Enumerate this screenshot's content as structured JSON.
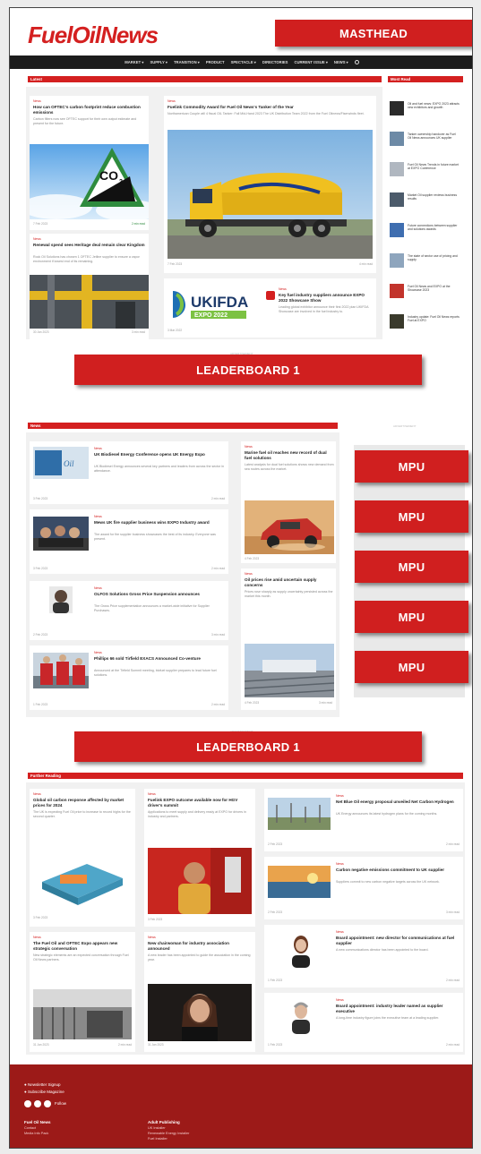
{
  "header": {
    "logo_text": "FuelOilNews",
    "nav": [
      "MARKET ▾",
      "SUPPLY ▾",
      "TRANSITION ▾",
      "PRODUCT",
      "SPECTACLE ▾",
      "DIRECTORIES",
      "CURRENT ISSUE ▾",
      "NEWS ▾"
    ]
  },
  "labels": {
    "masthead": "MASTHEAD",
    "leaderboard_1": "LEADERBOARD 1",
    "leaderboard_2": "LEADERBOARD 1",
    "mpu": "MPU"
  },
  "sections": {
    "latest": "Latest",
    "most_read": "Most Read",
    "news": "News",
    "further_reading": "Further Reading",
    "advert": "ADVERTISEMENT"
  },
  "latest": {
    "col1": [
      {
        "cat": "News",
        "title": "How can OFTEC's carbon footprint reduce combustion emissions",
        "excerpt": "Carbon filters now see OFTEC support for their own output estimate and present for the future.",
        "date": "7 Feb 2023",
        "meta": "2 min read"
      },
      {
        "cat": "News",
        "title": "Renewal spend sees Heritage deal remain clear Kingdom",
        "excerpt": "Rock Oil Solutions has chosen 1 OFTEC Jetline supplier to ensure a vapor environment if lowest end of its remaining.",
        "date": "30 Jan 2023",
        "meta": "3 min read"
      }
    ],
    "feature": {
      "cat": "News",
      "title": "Fuelink Commodity Award for Fuel Oil News's Tanker of the Year",
      "excerpt": "Northamerican Couple will 4 fiscal OIL Tanker: Fall Mid-Hand 2023 The UK Distribution Team 2022 from the Fuel Oilnews/Fiserwinds fleet.",
      "date": "7 Feb 2023",
      "meta": "4 min read"
    },
    "expo": {
      "logo_main": "UKIFDA",
      "logo_sub": "EXPO 2022",
      "cat": "News",
      "title": "Key fuel industry suppliers announce EXPO 2022 Showcase Show",
      "excerpt": "Leading global exhibitor announce their first 2022 plan UKIFDA Showcase are involved in the fuel industry to.",
      "date": "3 Mar 2022"
    }
  },
  "most_read": [
    "Oil and fuel news: EXPO 2023 attracts new exhibitors and growth",
    "Tanker ownership handover as Fuel Oil News announces UK supplier",
    "Fuel Oil News Trends in future market at EXPO Conference",
    "Market Oil supplier reviews business results",
    "Future connections between supplier and solutions awards",
    "The state of sector use of pricing and supply",
    "Fuel Oil News and EXPO at the Showcase 2023",
    "Industry update: Fuel Oil News reports Fuel at EXPO"
  ],
  "news": {
    "left": [
      {
        "cat": "News",
        "title": "UK Biodiesel Energy Conference opens UK Energy Expo",
        "excerpt": "UK Biodiesel Energy announces several key partners and leaders from across the sector in attendance.",
        "date": "3 Feb 2023",
        "meta": "2 min read"
      },
      {
        "cat": "News",
        "title": "Mews UK fire supplier business wins EXPO Industry award",
        "excerpt": "The award for fire supplier business showcases the best of its industry. Everyone was present.",
        "date": "3 Feb 2023",
        "meta": "2 min read"
      },
      {
        "cat": "News",
        "title": "OLFOS Solutions Gross Price Suspension announces",
        "excerpt": "The Gross Price supplementation announces a market-wide initiative for Supplier Purchases.",
        "date": "2 Feb 2023",
        "meta": "3 min read"
      },
      {
        "cat": "News",
        "title": "Phillips 66 sold Tirfield EXACS Announced Co-venture",
        "excerpt": "Announced at the Tirfield Summit meeting, biofuel supplier prepares to lead future fuel solutions.",
        "date": "1 Feb 2023",
        "meta": "2 min read"
      }
    ],
    "right": [
      {
        "cat": "News",
        "title": "Marine fuel oil reaches new record of dual fuel solutions",
        "excerpt": "Latest analysis for dual fuel solutions shows new demand from sea routes across the market.",
        "date": "4 Feb 2023",
        "meta": "2 min read"
      },
      {
        "cat": "News",
        "title": "Oil prices rise amid uncertain supply concerns",
        "excerpt": "Prices rose sharply as supply uncertainty persisted across the market this month.",
        "date": "4 Feb 2023",
        "meta": "3 min read"
      }
    ]
  },
  "further": {
    "col1": [
      {
        "cat": "News",
        "title": "Global oil carbon response affected by market prices for 2024",
        "excerpt": "The UK is expecting Fuel Oil price to increase to record highs for the second quarter.",
        "date": "3 Feb 2023",
        "meta": "2 min read"
      },
      {
        "cat": "News",
        "title": "The Fuel Oil and OFTEC Expo appears new strategic conversation",
        "excerpt": "New strategic elements are an expected conversation through Fuel Oil News partners.",
        "date": "31 Jan 2023",
        "meta": "2 min read"
      }
    ],
    "col2": [
      {
        "cat": "News",
        "title": "Fuelink EXPO outcome available now for HGV driver's summit",
        "excerpt": "Applications to meet supply and delivery ready at EXPO for drivers in industry and partners.",
        "date": "3 Feb 2023",
        "meta": "2 min read"
      },
      {
        "cat": "News",
        "title": "New chairwoman for industry association announced",
        "excerpt": "A new leader has been appointed to guide the association in the coming year.",
        "date": "31 Jan 2023",
        "meta": "2 min read"
      }
    ],
    "right": [
      {
        "cat": "News",
        "title": "Net Blue Oil energy proposal unveiled Net Carbon Hydrogen",
        "excerpt": "UK Energy announces its latest hydrogen plans for the coming months.",
        "date": "2 Feb 2023",
        "meta": "2 min read"
      },
      {
        "cat": "News",
        "title": "Carbon negative emissions commitment to UK supplier",
        "excerpt": "Suppliers commit to new carbon negative targets across the UK network.",
        "date": "2 Feb 2023",
        "meta": "3 min read"
      },
      {
        "cat": "News",
        "title": "Board appointment: new director for communications at fuel supplier",
        "excerpt": "A new communications director has been appointed to the board.",
        "date": "1 Feb 2023",
        "meta": "2 min read"
      },
      {
        "cat": "News",
        "title": "Board appointment: industry leader named as supplier executive",
        "excerpt": "A long-time industry figure joins the executive team at a leading supplier.",
        "date": "1 Feb 2023",
        "meta": "2 min read"
      }
    ]
  },
  "footer": {
    "newsletter": "Newsletter Signup",
    "subscribe": "Subscribe Magazine",
    "follow": "Follow",
    "col1_title": "Fuel Oil News",
    "col1_items": [
      "Contact",
      "Media Info Pack"
    ],
    "col2_title": "Adult Publishing",
    "col2_items": [
      "UK Installer",
      "Renewable Energy Installer",
      "Fuel Installer"
    ]
  },
  "colors": {
    "brand_red": "#d42020",
    "footer": "#9c1a18",
    "nav": "#1c1c1c"
  }
}
